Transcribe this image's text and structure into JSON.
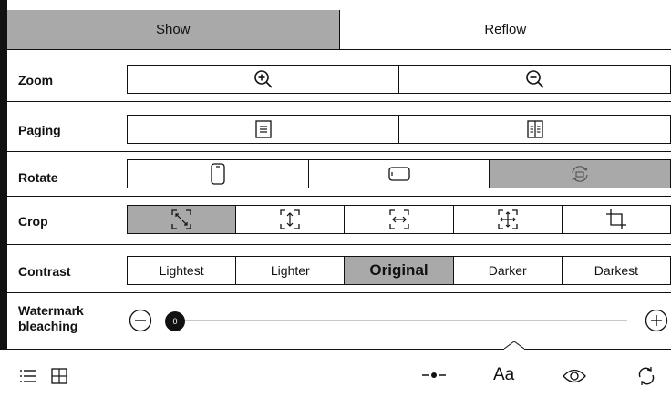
{
  "tabs": {
    "show": "Show",
    "reflow": "Reflow"
  },
  "rows": {
    "zoom": "Zoom",
    "paging": "Paging",
    "rotate": "Rotate",
    "crop": "Crop",
    "contrast": "Contrast",
    "watermark": "Watermark bleaching"
  },
  "contrast_options": [
    "Lightest",
    "Lighter",
    "Original",
    "Darker",
    "Darkest"
  ],
  "selected_contrast": "Original",
  "watermark_level": "0",
  "toolbar": {
    "font_label": "Aa"
  },
  "colors": {
    "selected": "#a9a9a9",
    "border": "#111111"
  }
}
